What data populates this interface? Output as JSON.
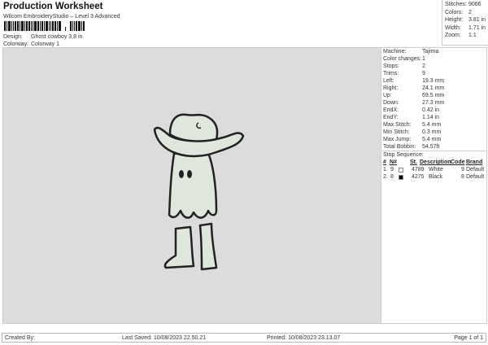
{
  "header": {
    "title": "Production Worksheet",
    "subtitle": "Wilcom EmbroideryStudio – Level 3 Advanced",
    "design_label": "Design:",
    "design_value": "Ghost cowboy 3,8 in",
    "colorway_label": "Colorway:",
    "colorway_value": "Colorway 1"
  },
  "summary": [
    {
      "label": "Stitches:",
      "value": "9066"
    },
    {
      "label": "Colors:",
      "value": "2"
    },
    {
      "label": "Height:",
      "value": "3.81 in"
    },
    {
      "label": "Width:",
      "value": "1.71 in"
    },
    {
      "label": "Zoom:",
      "value": "1:1"
    }
  ],
  "details": [
    {
      "label": "Machine:",
      "value": "Tajima"
    },
    {
      "label": "Color changes:",
      "value": "1"
    },
    {
      "label": "Stops:",
      "value": "2"
    },
    {
      "label": "Trims:",
      "value": "9"
    },
    {
      "label": "Left:",
      "value": "19.3 mm"
    },
    {
      "label": "Right:",
      "value": "24.1 mm"
    },
    {
      "label": "Up:",
      "value": "69.5 mm"
    },
    {
      "label": "Down:",
      "value": "27.3 mm"
    },
    {
      "label": "EndX:",
      "value": "0.42 in"
    },
    {
      "label": "EndY:",
      "value": "1.14 in"
    },
    {
      "label": "Max Stitch:",
      "value": "5.4 mm"
    },
    {
      "label": "Min Stitch:",
      "value": "0.3 mm"
    },
    {
      "label": "Max Jump:",
      "value": "5.4 mm"
    },
    {
      "label": "Total Bobbin:",
      "value": "54.57ft"
    }
  ],
  "stop_sequence": {
    "title": "Stop Sequence:",
    "columns": [
      "#",
      "N#",
      "St.",
      "Description",
      "Code",
      "Brand"
    ],
    "rows": [
      {
        "num": "1.",
        "n": "9",
        "color": "#ffffff",
        "st": "4789",
        "desc": "White",
        "code": "9",
        "brand": "Default"
      },
      {
        "num": "2.",
        "n": "8",
        "color": "#000000",
        "st": "4275",
        "desc": "Black",
        "code": "8",
        "brand": "Default"
      }
    ]
  },
  "footer": {
    "created_by": "Created By:",
    "last_saved": "Last Saved: 10/08/2023 22.50.21",
    "printed": "Printed: 10/08/2023 23.13.07",
    "page": "Page 1 of 1"
  },
  "colors": {
    "canvas": "#dcdcdc",
    "fill": "#dfe6dc",
    "outline": "#222222"
  }
}
